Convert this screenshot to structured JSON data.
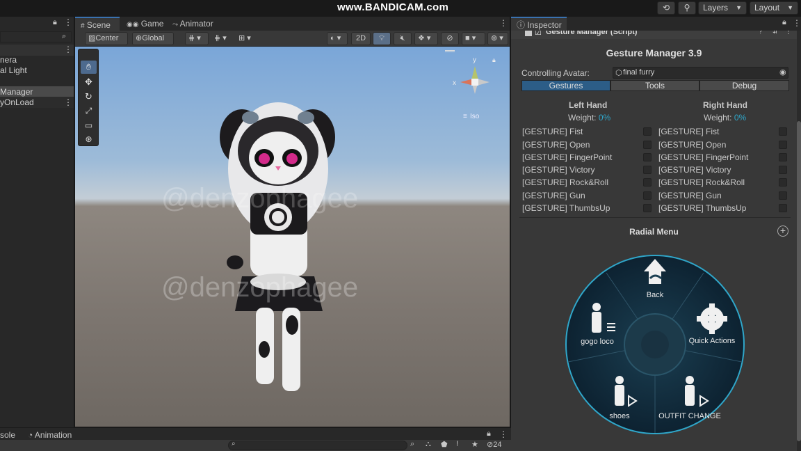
{
  "watermark_bandicam": "www.BANDICAM.com",
  "topbar": {
    "layers_label": "Layers",
    "layout_label": "Layout"
  },
  "hierarchy": {
    "items": [
      "nera",
      "al Light",
      "Manager",
      "yOnLoad"
    ]
  },
  "scene_tabs": {
    "scene": "Scene",
    "game": "Game",
    "animator": "Animator"
  },
  "scene_toolbar": {
    "pivot": "Center",
    "space": "Global",
    "mode_2d": "2D"
  },
  "gizmo": {
    "y": "y",
    "x": "x",
    "iso": "Iso"
  },
  "watermark_text": "@denzophagee",
  "inspector": {
    "tab": "Inspector",
    "component": "Gesture Manager (Script)",
    "title": "Gesture Manager 3.9",
    "controlling_label": "Controlling Avatar:",
    "avatar_value": "final furry",
    "tabs": [
      "Gestures",
      "Tools",
      "Debug"
    ],
    "left_hand": "Left Hand",
    "right_hand": "Right Hand",
    "weight_label": "Weight:",
    "left_weight": "0%",
    "right_weight": "0%",
    "gestures": [
      "[GESTURE] Fist",
      "[GESTURE] Open",
      "[GESTURE] FingerPoint",
      "[GESTURE] Victory",
      "[GESTURE] Rock&Roll",
      "[GESTURE] Gun",
      "[GESTURE] ThumbsUp"
    ],
    "radial_title": "Radial Menu",
    "radial_items": {
      "back": "Back",
      "quick": "Quick Actions",
      "gogo": "gogo loco",
      "shoes": "shoes",
      "outfit": "OUTFIT CHANGE"
    }
  },
  "bottom": {
    "console": "sole",
    "animation": "Animation",
    "count": "24"
  },
  "colors": {
    "accent": "#2fa6c9",
    "panel": "#383838",
    "tab_active": "#2c5d87"
  }
}
